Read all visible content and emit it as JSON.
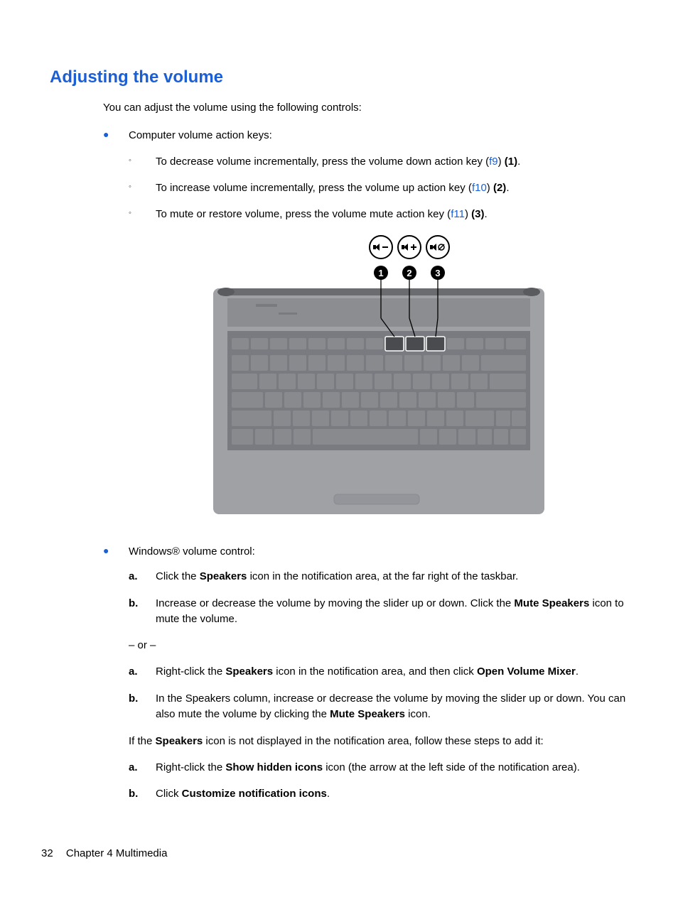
{
  "heading": "Adjusting the volume",
  "intro": "You can adjust the volume using the following controls:",
  "bullets": [
    {
      "text": "Computer volume action keys:",
      "subs": [
        {
          "pre": "To decrease volume incrementally, press the volume down action key (",
          "key": "f9",
          "post": ") ",
          "bold": "(1)",
          "tail": "."
        },
        {
          "pre": "To increase volume incrementally, press the volume up action key (",
          "key": "f10",
          "post": ") ",
          "bold": "(2)",
          "tail": "."
        },
        {
          "pre": "To mute or restore volume, press the volume mute action key (",
          "key": "f11",
          "post": ") ",
          "bold": "(3)",
          "tail": "."
        }
      ]
    },
    {
      "text": "Windows® volume control:",
      "alpha1": [
        {
          "m": "a.",
          "parts": [
            "Click the ",
            "Speakers",
            " icon in the notification area, at the far right of the taskbar."
          ]
        },
        {
          "m": "b.",
          "parts": [
            "Increase or decrease the volume by moving the slider up or down. Click the ",
            "Mute Speakers",
            " icon to mute the volume."
          ]
        }
      ],
      "or": "– or –",
      "alpha2": [
        {
          "m": "a.",
          "parts": [
            "Right-click the ",
            "Speakers",
            " icon in the notification area, and then click ",
            "Open Volume Mixer",
            "."
          ]
        },
        {
          "m": "b.",
          "parts": [
            "In the Speakers column, increase or decrease the volume by moving the slider up or down. You can also mute the volume by clicking the ",
            "Mute Speakers",
            " icon."
          ]
        }
      ],
      "note": {
        "pre": "If the ",
        "bold": "Speakers",
        "post": " icon is not displayed in the notification area, follow these steps to add it:"
      },
      "alpha3": [
        {
          "m": "a.",
          "parts": [
            "Right-click the ",
            "Show hidden icons",
            " icon (the arrow at the left side of the notification area)."
          ]
        },
        {
          "m": "b.",
          "parts": [
            "Click ",
            "Customize notification icons",
            "."
          ]
        }
      ]
    }
  ],
  "footer": {
    "page": "32",
    "chapter": "Chapter 4   Multimedia"
  }
}
